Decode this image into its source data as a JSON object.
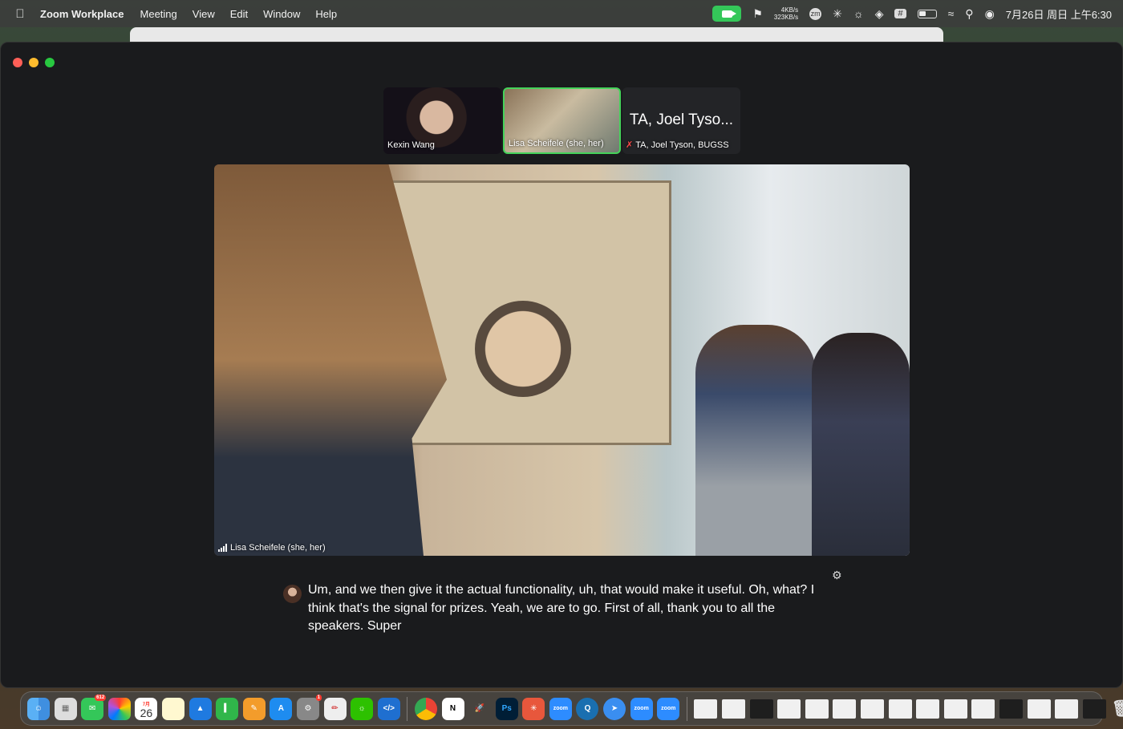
{
  "menubar": {
    "app_name": "Zoom Workplace",
    "menus": [
      "Meeting",
      "View",
      "Edit",
      "Window",
      "Help"
    ],
    "net_up": "4KB/s",
    "net_down": "323KB/s",
    "zoom_status": "zm",
    "clock": "7月26日 周日 上午6:30"
  },
  "gallery": {
    "tiles": [
      {
        "name": "Kexin Wang"
      },
      {
        "name": "Lisa Scheifele (she, her)",
        "active": true
      },
      {
        "big_name": "TA, Joel Tyso...",
        "name": "TA, Joel Tyson, BUGSS",
        "muted": true
      }
    ]
  },
  "main_video": {
    "speaker_label": "Lisa Scheifele (she, her)"
  },
  "caption": {
    "text": "Um, and we then give it the actual functionality, uh, that would make it useful. Oh, what? I think that's the signal for prizes. Yeah, we are to go. First of all, thank you to all the speakers. Super"
  },
  "dock": {
    "messages_badge": "612",
    "settings_badge": "1",
    "calendar_month": "7月",
    "calendar_day": "26",
    "zoom_label": "zoom",
    "ps_label": "Ps"
  },
  "colors": {
    "active_border": "#45d35a",
    "window_bg": "#1a1b1d",
    "muted": "#ff4b4b"
  }
}
